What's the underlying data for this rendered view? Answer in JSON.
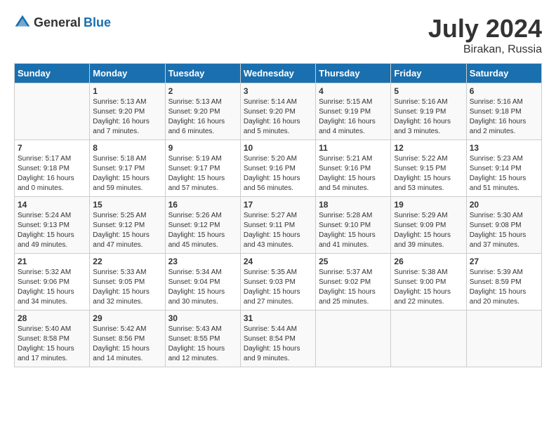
{
  "header": {
    "logo_general": "General",
    "logo_blue": "Blue",
    "month": "July 2024",
    "location": "Birakan, Russia"
  },
  "days_of_week": [
    "Sunday",
    "Monday",
    "Tuesday",
    "Wednesday",
    "Thursday",
    "Friday",
    "Saturday"
  ],
  "weeks": [
    [
      {
        "day": "",
        "sunrise": "",
        "sunset": "",
        "daylight": ""
      },
      {
        "day": "1",
        "sunrise": "Sunrise: 5:13 AM",
        "sunset": "Sunset: 9:20 PM",
        "daylight": "Daylight: 16 hours and 7 minutes."
      },
      {
        "day": "2",
        "sunrise": "Sunrise: 5:13 AM",
        "sunset": "Sunset: 9:20 PM",
        "daylight": "Daylight: 16 hours and 6 minutes."
      },
      {
        "day": "3",
        "sunrise": "Sunrise: 5:14 AM",
        "sunset": "Sunset: 9:20 PM",
        "daylight": "Daylight: 16 hours and 5 minutes."
      },
      {
        "day": "4",
        "sunrise": "Sunrise: 5:15 AM",
        "sunset": "Sunset: 9:19 PM",
        "daylight": "Daylight: 16 hours and 4 minutes."
      },
      {
        "day": "5",
        "sunrise": "Sunrise: 5:16 AM",
        "sunset": "Sunset: 9:19 PM",
        "daylight": "Daylight: 16 hours and 3 minutes."
      },
      {
        "day": "6",
        "sunrise": "Sunrise: 5:16 AM",
        "sunset": "Sunset: 9:18 PM",
        "daylight": "Daylight: 16 hours and 2 minutes."
      }
    ],
    [
      {
        "day": "7",
        "sunrise": "Sunrise: 5:17 AM",
        "sunset": "Sunset: 9:18 PM",
        "daylight": "Daylight: 16 hours and 0 minutes."
      },
      {
        "day": "8",
        "sunrise": "Sunrise: 5:18 AM",
        "sunset": "Sunset: 9:17 PM",
        "daylight": "Daylight: 15 hours and 59 minutes."
      },
      {
        "day": "9",
        "sunrise": "Sunrise: 5:19 AM",
        "sunset": "Sunset: 9:17 PM",
        "daylight": "Daylight: 15 hours and 57 minutes."
      },
      {
        "day": "10",
        "sunrise": "Sunrise: 5:20 AM",
        "sunset": "Sunset: 9:16 PM",
        "daylight": "Daylight: 15 hours and 56 minutes."
      },
      {
        "day": "11",
        "sunrise": "Sunrise: 5:21 AM",
        "sunset": "Sunset: 9:16 PM",
        "daylight": "Daylight: 15 hours and 54 minutes."
      },
      {
        "day": "12",
        "sunrise": "Sunrise: 5:22 AM",
        "sunset": "Sunset: 9:15 PM",
        "daylight": "Daylight: 15 hours and 53 minutes."
      },
      {
        "day": "13",
        "sunrise": "Sunrise: 5:23 AM",
        "sunset": "Sunset: 9:14 PM",
        "daylight": "Daylight: 15 hours and 51 minutes."
      }
    ],
    [
      {
        "day": "14",
        "sunrise": "Sunrise: 5:24 AM",
        "sunset": "Sunset: 9:13 PM",
        "daylight": "Daylight: 15 hours and 49 minutes."
      },
      {
        "day": "15",
        "sunrise": "Sunrise: 5:25 AM",
        "sunset": "Sunset: 9:12 PM",
        "daylight": "Daylight: 15 hours and 47 minutes."
      },
      {
        "day": "16",
        "sunrise": "Sunrise: 5:26 AM",
        "sunset": "Sunset: 9:12 PM",
        "daylight": "Daylight: 15 hours and 45 minutes."
      },
      {
        "day": "17",
        "sunrise": "Sunrise: 5:27 AM",
        "sunset": "Sunset: 9:11 PM",
        "daylight": "Daylight: 15 hours and 43 minutes."
      },
      {
        "day": "18",
        "sunrise": "Sunrise: 5:28 AM",
        "sunset": "Sunset: 9:10 PM",
        "daylight": "Daylight: 15 hours and 41 minutes."
      },
      {
        "day": "19",
        "sunrise": "Sunrise: 5:29 AM",
        "sunset": "Sunset: 9:09 PM",
        "daylight": "Daylight: 15 hours and 39 minutes."
      },
      {
        "day": "20",
        "sunrise": "Sunrise: 5:30 AM",
        "sunset": "Sunset: 9:08 PM",
        "daylight": "Daylight: 15 hours and 37 minutes."
      }
    ],
    [
      {
        "day": "21",
        "sunrise": "Sunrise: 5:32 AM",
        "sunset": "Sunset: 9:06 PM",
        "daylight": "Daylight: 15 hours and 34 minutes."
      },
      {
        "day": "22",
        "sunrise": "Sunrise: 5:33 AM",
        "sunset": "Sunset: 9:05 PM",
        "daylight": "Daylight: 15 hours and 32 minutes."
      },
      {
        "day": "23",
        "sunrise": "Sunrise: 5:34 AM",
        "sunset": "Sunset: 9:04 PM",
        "daylight": "Daylight: 15 hours and 30 minutes."
      },
      {
        "day": "24",
        "sunrise": "Sunrise: 5:35 AM",
        "sunset": "Sunset: 9:03 PM",
        "daylight": "Daylight: 15 hours and 27 minutes."
      },
      {
        "day": "25",
        "sunrise": "Sunrise: 5:37 AM",
        "sunset": "Sunset: 9:02 PM",
        "daylight": "Daylight: 15 hours and 25 minutes."
      },
      {
        "day": "26",
        "sunrise": "Sunrise: 5:38 AM",
        "sunset": "Sunset: 9:00 PM",
        "daylight": "Daylight: 15 hours and 22 minutes."
      },
      {
        "day": "27",
        "sunrise": "Sunrise: 5:39 AM",
        "sunset": "Sunset: 8:59 PM",
        "daylight": "Daylight: 15 hours and 20 minutes."
      }
    ],
    [
      {
        "day": "28",
        "sunrise": "Sunrise: 5:40 AM",
        "sunset": "Sunset: 8:58 PM",
        "daylight": "Daylight: 15 hours and 17 minutes."
      },
      {
        "day": "29",
        "sunrise": "Sunrise: 5:42 AM",
        "sunset": "Sunset: 8:56 PM",
        "daylight": "Daylight: 15 hours and 14 minutes."
      },
      {
        "day": "30",
        "sunrise": "Sunrise: 5:43 AM",
        "sunset": "Sunset: 8:55 PM",
        "daylight": "Daylight: 15 hours and 12 minutes."
      },
      {
        "day": "31",
        "sunrise": "Sunrise: 5:44 AM",
        "sunset": "Sunset: 8:54 PM",
        "daylight": "Daylight: 15 hours and 9 minutes."
      },
      {
        "day": "",
        "sunrise": "",
        "sunset": "",
        "daylight": ""
      },
      {
        "day": "",
        "sunrise": "",
        "sunset": "",
        "daylight": ""
      },
      {
        "day": "",
        "sunrise": "",
        "sunset": "",
        "daylight": ""
      }
    ]
  ]
}
